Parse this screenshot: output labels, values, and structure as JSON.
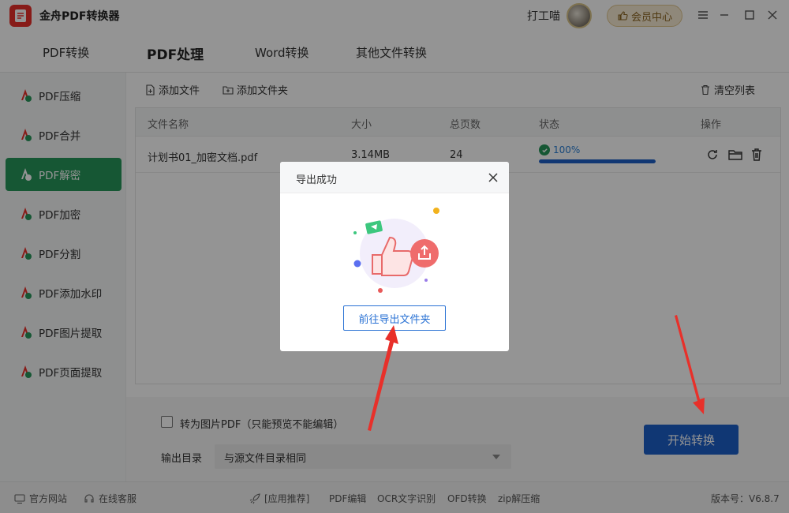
{
  "app": {
    "title": "金舟PDF转换器",
    "username": "打工喵",
    "vip_label": "会员中心"
  },
  "tabs": [
    {
      "label": "PDF转换"
    },
    {
      "label": "PDF处理"
    },
    {
      "label": "Word转换"
    },
    {
      "label": "其他文件转换"
    }
  ],
  "sidebar": {
    "items": [
      {
        "label": "PDF压缩"
      },
      {
        "label": "PDF合并"
      },
      {
        "label": "PDF解密"
      },
      {
        "label": "PDF加密"
      },
      {
        "label": "PDF分割"
      },
      {
        "label": "PDF添加水印"
      },
      {
        "label": "PDF图片提取"
      },
      {
        "label": "PDF页面提取"
      }
    ]
  },
  "toolbar": {
    "add_file": "添加文件",
    "add_folder": "添加文件夹",
    "clear_list": "清空列表"
  },
  "table": {
    "headers": {
      "name": "文件名称",
      "size": "大小",
      "pages": "总页数",
      "status": "状态",
      "actions": "操作"
    },
    "rows": [
      {
        "name": "计划书01_加密文档.pdf",
        "size": "3.14MB",
        "pages": "24",
        "status": "100%",
        "progress": 1.0
      }
    ]
  },
  "options": {
    "convert_image_label": "转为图片PDF（只能预览不能编辑）",
    "output_label": "输出目录",
    "output_value": "与源文件目录相同",
    "start_button": "开始转换"
  },
  "statusbar": {
    "official_site": "官方网站",
    "online_service": "在线客服",
    "recommend": "[应用推荐]",
    "apps": [
      "PDF编辑",
      "OCR文字识别",
      "OFD转换",
      "zip解压缩"
    ],
    "version": "版本号：V6.8.7"
  },
  "modal": {
    "title": "导出成功",
    "button": "前往导出文件夹"
  },
  "colors": {
    "accent_green": "#27965a",
    "accent_blue": "#1c5fc8",
    "arrow_red": "#e8302a"
  }
}
